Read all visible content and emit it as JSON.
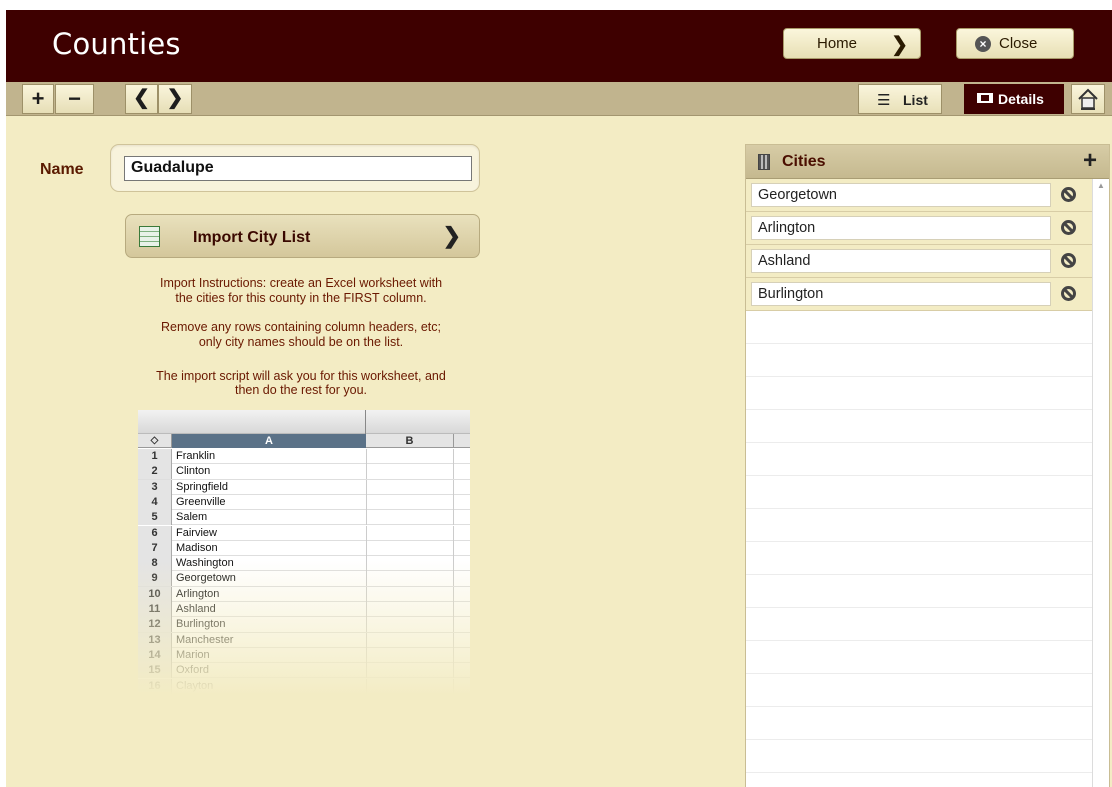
{
  "header": {
    "title": "Counties",
    "home_label": "Home",
    "close_label": "Close"
  },
  "toolbar": {
    "add": "+",
    "remove": "−",
    "prev": "‹",
    "next": "›",
    "list_label": "List",
    "details_label": "Details",
    "list_icon": "list-icon",
    "details_icon": "details-icon",
    "home_icon": "house-icon"
  },
  "form": {
    "name_label": "Name",
    "name_value": "Guadalupe",
    "import_label": "Import City List",
    "instructions": [
      "Import Instructions: create an Excel worksheet with",
      "the cities for this county in the FIRST column.",
      "Remove any rows containing column headers, etc;",
      "only city names should be on the list.",
      "The import script will ask you for this worksheet, and",
      "then do the rest for you."
    ]
  },
  "spreadsheet": {
    "corner": "◇",
    "columns": [
      "A",
      "B"
    ],
    "rows": [
      {
        "num": "1",
        "value": "Franklin"
      },
      {
        "num": "2",
        "value": "Clinton"
      },
      {
        "num": "3",
        "value": "Springfield"
      },
      {
        "num": "4",
        "value": "Greenville"
      },
      {
        "num": "5",
        "value": "Salem"
      },
      {
        "num": "6",
        "value": "Fairview"
      },
      {
        "num": "7",
        "value": "Madison"
      },
      {
        "num": "8",
        "value": "Washington"
      },
      {
        "num": "9",
        "value": "Georgetown"
      },
      {
        "num": "10",
        "value": "Arlington"
      },
      {
        "num": "11",
        "value": "Ashland"
      },
      {
        "num": "12",
        "value": "Burlington"
      },
      {
        "num": "13",
        "value": "Manchester"
      },
      {
        "num": "14",
        "value": "Marion"
      },
      {
        "num": "15",
        "value": "Oxford"
      },
      {
        "num": "16",
        "value": "Clayton"
      }
    ]
  },
  "cities": {
    "title": "Cities",
    "add": "+",
    "items": [
      "Georgetown",
      "Arlington",
      "Ashland",
      "Burlington"
    ]
  },
  "colors": {
    "header_bg": "#3e0000",
    "page_bg": "#f3ecc4",
    "toolbar_bg": "#c1b48e",
    "label_text": "#5a1a00"
  }
}
